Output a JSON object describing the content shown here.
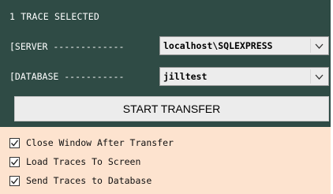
{
  "header": {
    "title": "1 TRACE SELECTED"
  },
  "server": {
    "label": "[SERVER -------------",
    "selected": "localhost\\SQLEXPRESS"
  },
  "database": {
    "label": "[DATABASE -----------",
    "selected": "jilltest"
  },
  "actions": {
    "start_label": "START TRANSFER"
  },
  "options": [
    {
      "label": "Close Window After Transfer",
      "checked": true
    },
    {
      "label": "Load Traces To Screen",
      "checked": true
    },
    {
      "label": "Send Traces to Database",
      "checked": true
    }
  ],
  "colors": {
    "top_panel": "#2f4b45",
    "bottom_panel": "#fde3cf",
    "button": "#ececec",
    "label_text": "#ffffff"
  },
  "icons": {
    "dropdown": "chevron-down-icon",
    "check": "checkmark-icon"
  }
}
